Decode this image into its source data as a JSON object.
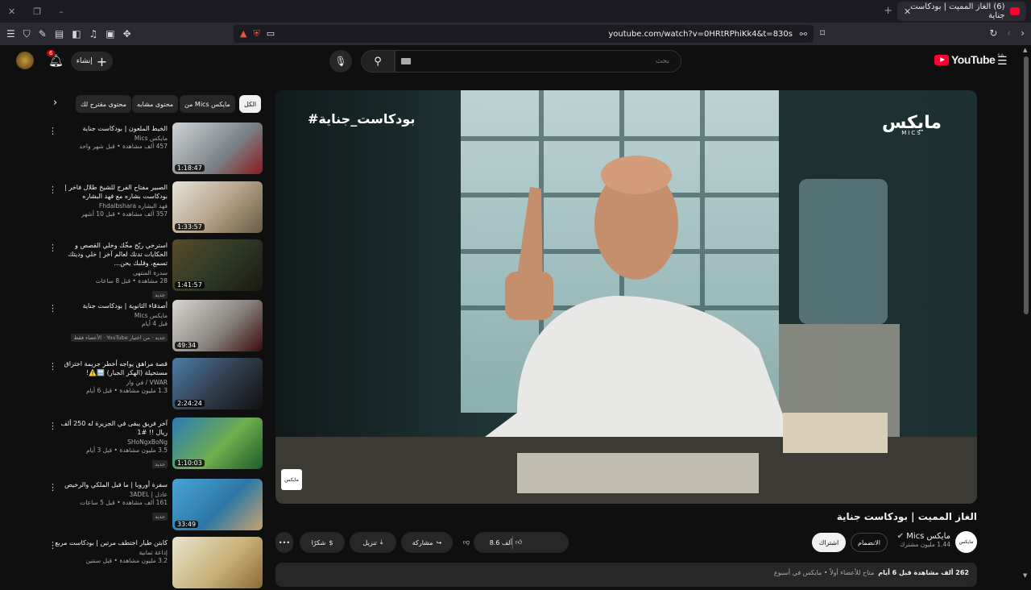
{
  "browser": {
    "tab_title": "(6) الغاز المميت | بودكاست جناية",
    "url": "youtube.com/watch?v=0HRtRPhiKk4&t=830s"
  },
  "masthead": {
    "logo_text": "YouTube",
    "country_code": "SA",
    "search_placeholder": "بحث",
    "create_label": "إنشاء",
    "notif_count": "6"
  },
  "chips": [
    {
      "label": "الكل"
    },
    {
      "label": "من Mics مايكس"
    },
    {
      "label": "محتوى مشابه"
    },
    {
      "label": "محتوى مقترح لك"
    }
  ],
  "related": [
    {
      "title": "الخيط الملعون | بودكاست جناية",
      "channel": "مايكس Mics",
      "meta": "457 ألف مشاهدة • قبل شهر واحد",
      "badge": "",
      "duration": "1:18:47"
    },
    {
      "title": "الصبير مفتاح الفرج للشيخ طلال فاخر | بودكاست بشاره مع فهد البشاره",
      "channel": "فهد البشاره Fhdalbshara",
      "meta": "357 ألف مشاهدة • قبل 10 أشهر",
      "badge": "",
      "duration": "1:33:57"
    },
    {
      "title": "استرخي ريّح مخّك وخلي القصص و الحكايات تدتك لعالم آخر | خلي وديتك تسمع، وقلبك يحن...",
      "channel": "سدرة المنتهى",
      "meta": "28 مشاهدة • قبل 8 ساعات",
      "badge": "جديد",
      "duration": "1:41:57"
    },
    {
      "title": "أصدقاء الثانوية | بودكاست جناية",
      "channel": "مايكس Mics",
      "meta": "قبل 4 أيام",
      "badge": "جديد · من اختيار YouTube · الأعضاء فقط",
      "duration": "49:34"
    },
    {
      "title": "قصة مراهق يواجه أخطر جريمة اختراق مستحيلة (الهكر الجبار) 🔛⚠️!",
      "channel": "VWAR / في وار",
      "meta": "1.3 مليون مشاهدة • قبل 6 أيام",
      "badge": "",
      "duration": "2:24:24"
    },
    {
      "title": "آخر فريق يبقى في الجزيرة له 250 ألف ريال !! #1",
      "channel": "SHoNgxBoNg",
      "meta": "3.5 مليون مشاهدة • قبل 3 أيام",
      "badge": "جديد",
      "duration": "1:10:03"
    },
    {
      "title": "سفرة أوروبا | ما قبل الملكي والرخيص",
      "channel": "عادل | 3ADEL",
      "meta": "161 ألف مشاهدة • قبل 5 ساعات",
      "badge": "جديد",
      "duration": "33:49"
    },
    {
      "title": "كابتن طيار اختطف مرتين | بودكاست مربع",
      "channel": "إذاعة ثمانية",
      "meta": "3.2 مليون مشاهدة • قبل سنتين",
      "badge": "",
      "duration": ""
    }
  ],
  "player": {
    "hashtag": "#بودكاست_جناية",
    "brand_ar": "مايكس",
    "brand_en": "MICS",
    "watermark": "مايكس"
  },
  "video": {
    "title": "الغاز المميت | بودكاست جناية",
    "channel": "مايكس Mics",
    "subs": "1.44 مليون مشترك",
    "join": "الانضمام",
    "subscribe": "اشتراك",
    "likes": "8.6 ألف",
    "share": "مشاركة",
    "download": "تنزيل",
    "thanks": "شكرًا",
    "desc_views": "262 ألف مشاهدة قبل 6 أيام",
    "desc_sub": "متاح للأعضاء أولاً • مايكس في أسبوع"
  },
  "colors": {
    "brand_red": "#ff0033",
    "bg": "#0f0f0f",
    "chip": "#272727"
  }
}
